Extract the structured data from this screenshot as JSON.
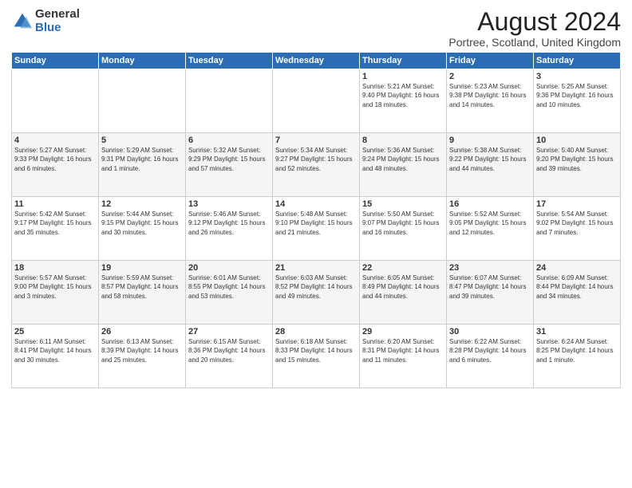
{
  "logo": {
    "general": "General",
    "blue": "Blue"
  },
  "title": "August 2024",
  "subtitle": "Portree, Scotland, United Kingdom",
  "headers": [
    "Sunday",
    "Monday",
    "Tuesday",
    "Wednesday",
    "Thursday",
    "Friday",
    "Saturday"
  ],
  "weeks": [
    [
      {
        "day": "",
        "info": ""
      },
      {
        "day": "",
        "info": ""
      },
      {
        "day": "",
        "info": ""
      },
      {
        "day": "",
        "info": ""
      },
      {
        "day": "1",
        "info": "Sunrise: 5:21 AM\nSunset: 9:40 PM\nDaylight: 16 hours\nand 18 minutes."
      },
      {
        "day": "2",
        "info": "Sunrise: 5:23 AM\nSunset: 9:38 PM\nDaylight: 16 hours\nand 14 minutes."
      },
      {
        "day": "3",
        "info": "Sunrise: 5:25 AM\nSunset: 9:36 PM\nDaylight: 16 hours\nand 10 minutes."
      }
    ],
    [
      {
        "day": "4",
        "info": "Sunrise: 5:27 AM\nSunset: 9:33 PM\nDaylight: 16 hours\nand 6 minutes."
      },
      {
        "day": "5",
        "info": "Sunrise: 5:29 AM\nSunset: 9:31 PM\nDaylight: 16 hours\nand 1 minute."
      },
      {
        "day": "6",
        "info": "Sunrise: 5:32 AM\nSunset: 9:29 PM\nDaylight: 15 hours\nand 57 minutes."
      },
      {
        "day": "7",
        "info": "Sunrise: 5:34 AM\nSunset: 9:27 PM\nDaylight: 15 hours\nand 52 minutes."
      },
      {
        "day": "8",
        "info": "Sunrise: 5:36 AM\nSunset: 9:24 PM\nDaylight: 15 hours\nand 48 minutes."
      },
      {
        "day": "9",
        "info": "Sunrise: 5:38 AM\nSunset: 9:22 PM\nDaylight: 15 hours\nand 44 minutes."
      },
      {
        "day": "10",
        "info": "Sunrise: 5:40 AM\nSunset: 9:20 PM\nDaylight: 15 hours\nand 39 minutes."
      }
    ],
    [
      {
        "day": "11",
        "info": "Sunrise: 5:42 AM\nSunset: 9:17 PM\nDaylight: 15 hours\nand 35 minutes."
      },
      {
        "day": "12",
        "info": "Sunrise: 5:44 AM\nSunset: 9:15 PM\nDaylight: 15 hours\nand 30 minutes."
      },
      {
        "day": "13",
        "info": "Sunrise: 5:46 AM\nSunset: 9:12 PM\nDaylight: 15 hours\nand 26 minutes."
      },
      {
        "day": "14",
        "info": "Sunrise: 5:48 AM\nSunset: 9:10 PM\nDaylight: 15 hours\nand 21 minutes."
      },
      {
        "day": "15",
        "info": "Sunrise: 5:50 AM\nSunset: 9:07 PM\nDaylight: 15 hours\nand 16 minutes."
      },
      {
        "day": "16",
        "info": "Sunrise: 5:52 AM\nSunset: 9:05 PM\nDaylight: 15 hours\nand 12 minutes."
      },
      {
        "day": "17",
        "info": "Sunrise: 5:54 AM\nSunset: 9:02 PM\nDaylight: 15 hours\nand 7 minutes."
      }
    ],
    [
      {
        "day": "18",
        "info": "Sunrise: 5:57 AM\nSunset: 9:00 PM\nDaylight: 15 hours\nand 3 minutes."
      },
      {
        "day": "19",
        "info": "Sunrise: 5:59 AM\nSunset: 8:57 PM\nDaylight: 14 hours\nand 58 minutes."
      },
      {
        "day": "20",
        "info": "Sunrise: 6:01 AM\nSunset: 8:55 PM\nDaylight: 14 hours\nand 53 minutes."
      },
      {
        "day": "21",
        "info": "Sunrise: 6:03 AM\nSunset: 8:52 PM\nDaylight: 14 hours\nand 49 minutes."
      },
      {
        "day": "22",
        "info": "Sunrise: 6:05 AM\nSunset: 8:49 PM\nDaylight: 14 hours\nand 44 minutes."
      },
      {
        "day": "23",
        "info": "Sunrise: 6:07 AM\nSunset: 8:47 PM\nDaylight: 14 hours\nand 39 minutes."
      },
      {
        "day": "24",
        "info": "Sunrise: 6:09 AM\nSunset: 8:44 PM\nDaylight: 14 hours\nand 34 minutes."
      }
    ],
    [
      {
        "day": "25",
        "info": "Sunrise: 6:11 AM\nSunset: 8:41 PM\nDaylight: 14 hours\nand 30 minutes."
      },
      {
        "day": "26",
        "info": "Sunrise: 6:13 AM\nSunset: 8:39 PM\nDaylight: 14 hours\nand 25 minutes."
      },
      {
        "day": "27",
        "info": "Sunrise: 6:15 AM\nSunset: 8:36 PM\nDaylight: 14 hours\nand 20 minutes."
      },
      {
        "day": "28",
        "info": "Sunrise: 6:18 AM\nSunset: 8:33 PM\nDaylight: 14 hours\nand 15 minutes."
      },
      {
        "day": "29",
        "info": "Sunrise: 6:20 AM\nSunset: 8:31 PM\nDaylight: 14 hours\nand 11 minutes."
      },
      {
        "day": "30",
        "info": "Sunrise: 6:22 AM\nSunset: 8:28 PM\nDaylight: 14 hours\nand 6 minutes."
      },
      {
        "day": "31",
        "info": "Sunrise: 6:24 AM\nSunset: 8:25 PM\nDaylight: 14 hours\nand 1 minute."
      }
    ]
  ]
}
